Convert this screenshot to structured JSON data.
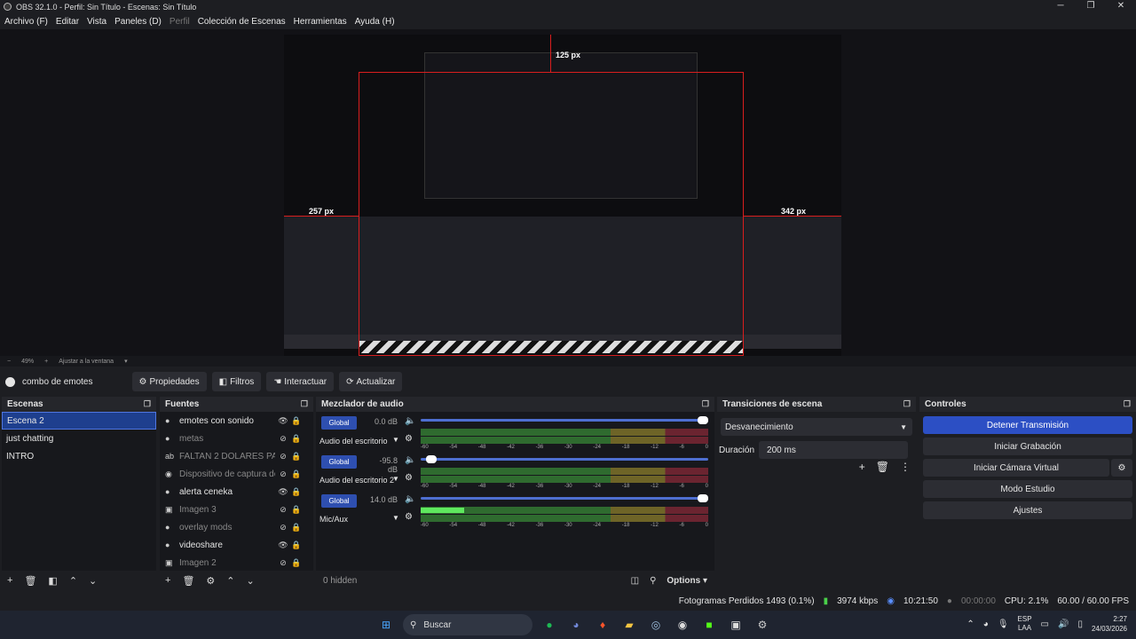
{
  "window": {
    "title": "OBS 32.1.0 - Perfil: Sin Título - Escenas: Sin Título",
    "controls": [
      "─",
      "❐",
      "✕"
    ]
  },
  "menu": [
    {
      "label": "Archivo (F)",
      "enabled": true
    },
    {
      "label": "Editar",
      "enabled": true
    },
    {
      "label": "Vista",
      "enabled": true
    },
    {
      "label": "Paneles (D)",
      "enabled": true
    },
    {
      "label": "Perfil",
      "enabled": false
    },
    {
      "label": "Colección de Escenas",
      "enabled": true
    },
    {
      "label": "Herramientas",
      "enabled": true
    },
    {
      "label": "Ayuda (H)",
      "enabled": true
    }
  ],
  "preview": {
    "labels": {
      "top": "125 px",
      "left": "257 px",
      "right": "342 px"
    },
    "zoom": "49%",
    "fit": "Ajustar a la ventana"
  },
  "source_toolbar": {
    "current_source": "combo de emotes",
    "properties": "Propiedades",
    "filters": "Filtros",
    "interact": "Interactuar",
    "refresh": "Actualizar"
  },
  "scenes": {
    "title": "Escenas",
    "items": [
      "Escena 2",
      "just chatting",
      "INTRO"
    ],
    "selected": 0
  },
  "sources": {
    "title": "Fuentes",
    "items": [
      {
        "name": "emotes con sonido",
        "visible": true,
        "type": "globe"
      },
      {
        "name": "metas",
        "visible": false,
        "type": "globe"
      },
      {
        "name": "FALTAN 2 DOLARES PARA E",
        "visible": false,
        "type": "text"
      },
      {
        "name": "Dispositivo de captura de v",
        "visible": false,
        "type": "camera"
      },
      {
        "name": "alerta ceneka",
        "visible": true,
        "type": "globe"
      },
      {
        "name": "Imagen 3",
        "visible": false,
        "type": "image"
      },
      {
        "name": "overlay mods",
        "visible": false,
        "type": "globe"
      },
      {
        "name": "videoshare",
        "visible": true,
        "type": "globe"
      },
      {
        "name": "Imagen 2",
        "visible": false,
        "type": "image"
      }
    ]
  },
  "mixer": {
    "title": "Mezclador de audio",
    "channels": [
      {
        "tag": "Global",
        "db": "0.0 dB",
        "name": "Audio del escritorio",
        "volume": 1.0,
        "level": 0
      },
      {
        "tag": "Global",
        "db": "-95.8 dB",
        "name": "Audio del escritorio 2",
        "volume": 0.02,
        "level": 0
      },
      {
        "tag": "Global",
        "db": "14.0 dB",
        "name": "Mic/Aux",
        "volume": 1.0,
        "level": 0.15
      }
    ],
    "ticks": [
      "-60",
      "-54",
      "-48",
      "-42",
      "-36",
      "-30",
      "-24",
      "-18",
      "-12",
      "-6",
      "0"
    ],
    "hidden": "0 hidden",
    "options": "Options"
  },
  "transitions": {
    "title": "Transiciones de escena",
    "selected": "Desvanecimiento",
    "duration_label": "Duración",
    "duration": "200 ms"
  },
  "controls": {
    "title": "Controles",
    "stop_stream": "Detener Transmisión",
    "start_recording": "Iniciar Grabación",
    "start_virtualcam": "Iniciar Cámara Virtual",
    "studio_mode": "Modo Estudio",
    "settings": "Ajustes"
  },
  "status": {
    "dropped": "Fotogramas Perdidos 1493 (0.1%)",
    "bitrate": "3974 kbps",
    "stream_time": "10:21:50",
    "rec_time": "00:00:00",
    "cpu": "CPU: 2.1%",
    "fps": "60.00 / 60.00 FPS"
  },
  "taskbar": {
    "search": "Buscar",
    "lang_top": "ESP",
    "lang_bottom": "LAA",
    "time": "2:27",
    "date": "24/03/2026",
    "badge": "99+"
  },
  "colors": {
    "accent": "#2c4fc4",
    "stream_ok": "#4ad04a",
    "guide": "#d81e1e"
  }
}
